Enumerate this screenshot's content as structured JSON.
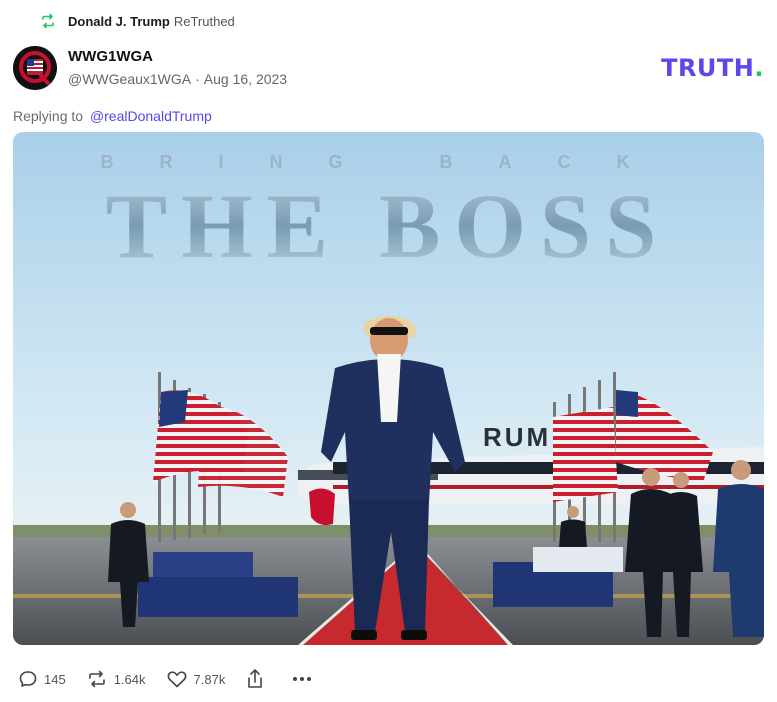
{
  "retruth": {
    "icon": "retruth-icon",
    "user": "Donald J. Trump",
    "verb": "ReTruthed",
    "icon_color": "#22c55e"
  },
  "post": {
    "display_name": "WWG1WGA",
    "handle": "@WWGeaux1WGA",
    "separator": "·",
    "date": "Aug 16, 2023",
    "avatar_letter": "Q",
    "reply_prefix": "Replying to",
    "reply_handle": "@realDonaldTrump"
  },
  "brand": {
    "text": "TRUTH",
    "dot": ".",
    "color": "#5b48e8",
    "dot_color": "#22c55e"
  },
  "image": {
    "top_line": "BRING BACK",
    "headline": "THE BOSS",
    "plane_text": "RUMP",
    "scene": [
      "blue sky",
      "flags",
      "airplane",
      "red carpet",
      "security agents"
    ]
  },
  "actions": {
    "replies": "145",
    "retruths": "1.64k",
    "likes": "7.87k",
    "share_icon": "share-icon",
    "more_icon": "more-icon"
  }
}
